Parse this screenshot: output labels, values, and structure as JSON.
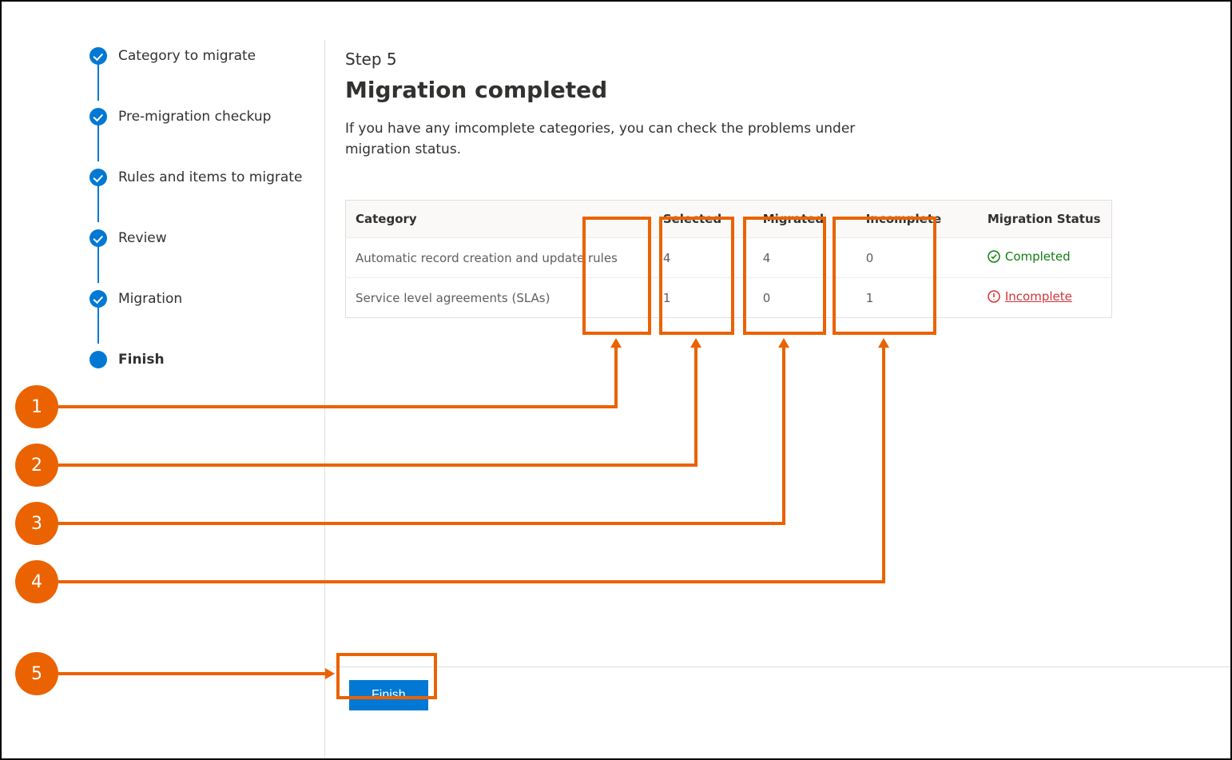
{
  "sidebar": {
    "items": [
      {
        "label": "Category to migrate",
        "state": "done"
      },
      {
        "label": "Pre-migration checkup",
        "state": "done"
      },
      {
        "label": "Rules and items to migrate",
        "state": "done"
      },
      {
        "label": "Review",
        "state": "done"
      },
      {
        "label": "Migration",
        "state": "done"
      },
      {
        "label": "Finish",
        "state": "current"
      }
    ]
  },
  "main": {
    "step_number": "Step 5",
    "title": "Migration completed",
    "description": "If you have any imcomplete categories, you can check the problems under migration status."
  },
  "table": {
    "headers": {
      "category": "Category",
      "selected": "Selected",
      "migrated": "Migrated",
      "incomplete": "Incomplete",
      "status": "Migration Status"
    },
    "rows": [
      {
        "category": "Automatic record creation and update rules",
        "selected": "4",
        "migrated": "4",
        "incomplete": "0",
        "status_label": "Completed",
        "status": "completed"
      },
      {
        "category": "Service level agreements (SLAs)",
        "selected": "1",
        "migrated": "0",
        "incomplete": "1",
        "status_label": "Incomplete",
        "status": "incomplete"
      }
    ]
  },
  "footer": {
    "finish_label": "Finish"
  },
  "callouts": {
    "n1": "1",
    "n2": "2",
    "n3": "3",
    "n4": "4",
    "n5": "5"
  },
  "colors": {
    "brand": "#0078d4",
    "callout": "#eb6200",
    "success": "#107c10",
    "error": "#d13438"
  }
}
